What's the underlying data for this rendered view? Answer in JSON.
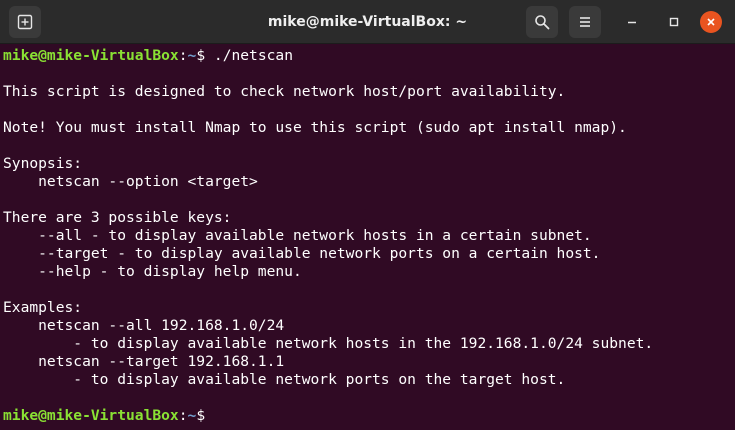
{
  "window": {
    "title": "mike@mike-VirtualBox: ~"
  },
  "icons": {
    "new_tab": "new-tab-icon",
    "search": "search-icon",
    "menu": "hamburger-menu-icon",
    "minimize": "minimize-icon",
    "maximize": "maximize-icon",
    "close": "close-icon"
  },
  "colors": {
    "terminal_bg": "#300a24",
    "prompt_user": "#8ae234",
    "prompt_path": "#729fcf",
    "close_button": "#e95420"
  },
  "terminal": {
    "prompt1": {
      "user_host": "mike@mike-VirtualBox",
      "colon": ":",
      "path": "~",
      "symbol": "$ ",
      "command": "./netscan"
    },
    "output": [
      "",
      "This script is designed to check network host/port availability.",
      "",
      "Note! You must install Nmap to use this script (sudo apt install nmap).",
      "",
      "Synopsis:",
      "    netscan --option <target>",
      "",
      "There are 3 possible keys:",
      "    --all - to display available network hosts in a certain subnet.",
      "    --target - to display available network ports on a certain host.",
      "    --help - to display help menu.",
      "",
      "Examples:",
      "    netscan --all 192.168.1.0/24",
      "        - to display available network hosts in the 192.168.1.0/24 subnet.",
      "    netscan --target 192.168.1.1",
      "        - to display available network ports on the target host.",
      ""
    ],
    "prompt2": {
      "user_host": "mike@mike-VirtualBox",
      "colon": ":",
      "path": "~",
      "symbol": "$",
      "command": ""
    }
  }
}
